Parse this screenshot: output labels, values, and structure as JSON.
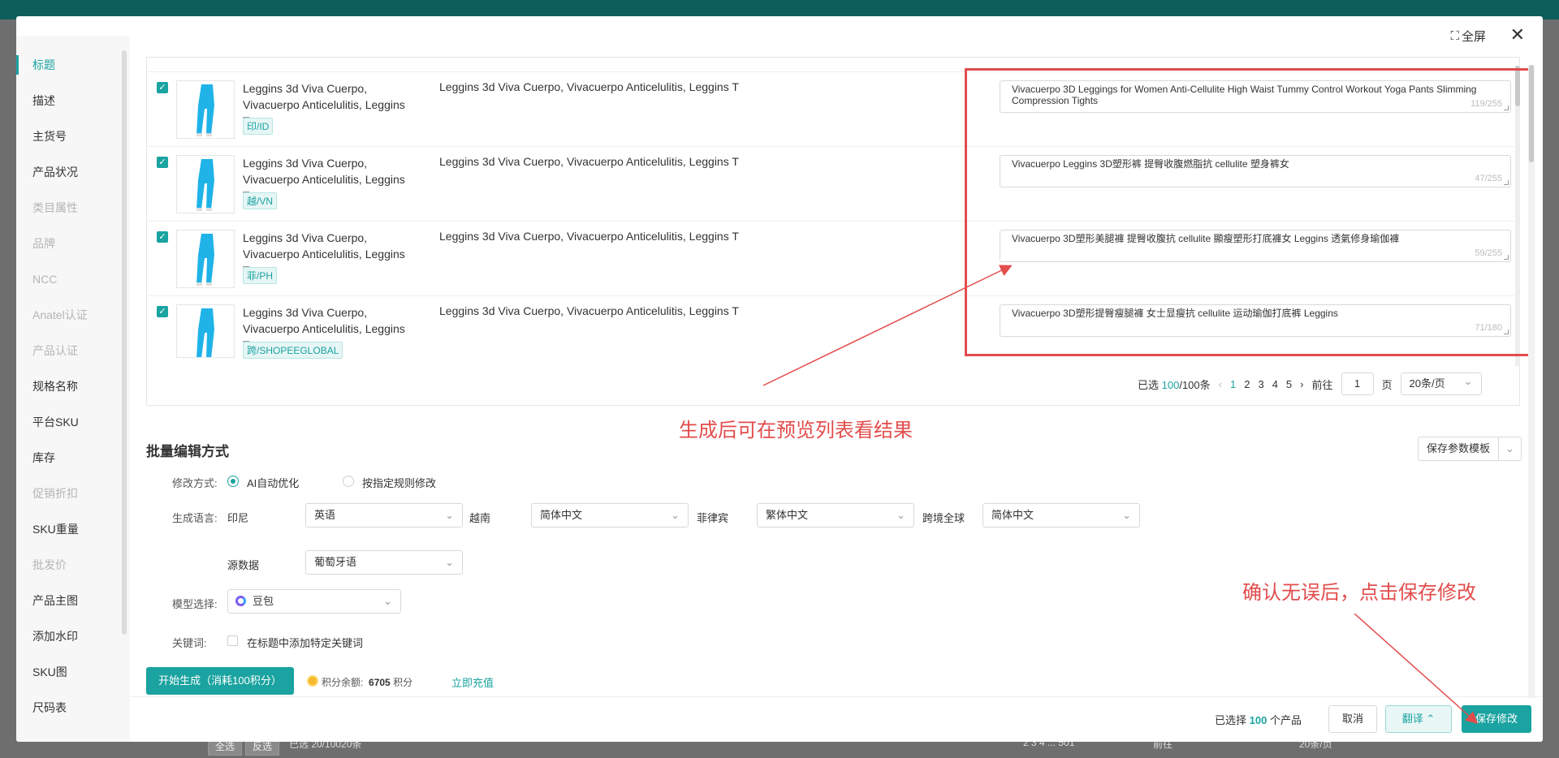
{
  "modal": {
    "fullscreen_label": "全屏"
  },
  "sidebar": {
    "items": [
      {
        "label": "标题",
        "state": "active"
      },
      {
        "label": "描述",
        "state": "normal"
      },
      {
        "label": "主货号",
        "state": "normal"
      },
      {
        "label": "产品状况",
        "state": "normal"
      },
      {
        "label": "类目属性",
        "state": "disabled"
      },
      {
        "label": "品牌",
        "state": "disabled"
      },
      {
        "label": "NCC",
        "state": "disabled"
      },
      {
        "label": "Anatel认证",
        "state": "disabled"
      },
      {
        "label": "产品认证",
        "state": "disabled"
      },
      {
        "label": "规格名称",
        "state": "normal"
      },
      {
        "label": "平台SKU",
        "state": "normal"
      },
      {
        "label": "库存",
        "state": "normal"
      },
      {
        "label": "促销折扣",
        "state": "disabled"
      },
      {
        "label": "SKU重量",
        "state": "normal"
      },
      {
        "label": "批发价",
        "state": "disabled"
      },
      {
        "label": "产品主图",
        "state": "normal"
      },
      {
        "label": "添加水印",
        "state": "normal"
      },
      {
        "label": "SKU图",
        "state": "normal"
      },
      {
        "label": "尺码表",
        "state": "normal"
      }
    ]
  },
  "rows": [
    {
      "title": "Leggins 3d Viva Cuerpo, Vivacuerpo Anticelulitis, Leggins T",
      "tag": "印/ID",
      "original": "Leggins 3d Viva Cuerpo, Vivacuerpo Anticelulitis, Leggins T",
      "generated": "Vivacuerpo 3D Leggings for Women Anti-Cellulite High Waist Tummy Control Workout Yoga Pants Slimming Compression Tights",
      "count": "119/255"
    },
    {
      "title": "Leggins 3d Viva Cuerpo, Vivacuerpo Anticelulitis, Leggins T",
      "tag": "越/VN",
      "original": "Leggins 3d Viva Cuerpo, Vivacuerpo Anticelulitis, Leggins T",
      "generated": "Vivacuerpo Leggins 3D塑形裤 提臀收腹燃脂抗 cellulite 塑身裤女",
      "count": "47/255"
    },
    {
      "title": "Leggins 3d Viva Cuerpo, Vivacuerpo Anticelulitis, Leggins T",
      "tag": "菲/PH",
      "original": "Leggins 3d Viva Cuerpo, Vivacuerpo Anticelulitis, Leggins T",
      "generated": "Vivacuerpo 3D塑形美腿褲 提臀收腹抗 cellulite 顯瘦塑形打底褲女 Leggins 透氣修身瑜伽褲",
      "count": "59/255"
    },
    {
      "title": "Leggins 3d Viva Cuerpo, Vivacuerpo Anticelulitis, Leggins T",
      "tag": "跨/SHOPEEGLOBAL",
      "original": "Leggins 3d Viva Cuerpo, Vivacuerpo Anticelulitis, Leggins T",
      "generated": "Vivacuerpo 3D塑形提臀瘦腿褲 女士显瘦抗 cellulite 运动瑜伽打底裤 Leggins",
      "count": "71/180"
    }
  ],
  "pager": {
    "selected_prefix": "已选 ",
    "selected": "100",
    "total_suffix": "/100条",
    "pages": [
      "1",
      "2",
      "3",
      "4",
      "5"
    ],
    "goto_label": "前往",
    "goto_value": "1",
    "page_unit": "页",
    "page_size": "20条/页"
  },
  "annotations": {
    "preview": "生成后可在预览列表看结果",
    "save": "确认无误后，点击保存修改"
  },
  "batch": {
    "section_title": "批量编辑方式",
    "template_button": "保存参数模板",
    "mode_label": "修改方式:",
    "mode_ai": "AI自动优化",
    "mode_rule": "按指定规则修改",
    "lang_label": "生成语言:",
    "langs": [
      {
        "site": "印尼",
        "value": "英语"
      },
      {
        "site": "越南",
        "value": "简体中文"
      },
      {
        "site": "菲律宾",
        "value": "繁体中文"
      },
      {
        "site": "跨境全球",
        "value": "简体中文"
      }
    ],
    "source_label": "源数据",
    "source_value": "葡萄牙语",
    "model_label": "模型选择:",
    "model_value": "豆包",
    "keyword_label": "关键词:",
    "keyword_option": "在标题中添加特定关键词",
    "generate_button": "开始生成（消耗100积分）",
    "points_label": "积分余额:",
    "points_value": "6705",
    "points_unit": "积分",
    "recharge": "立即充值"
  },
  "footer": {
    "selected_prefix": "已选择",
    "selected_count": "100",
    "selected_suffix": "个产品",
    "cancel": "取消",
    "translate": "翻译",
    "save": "保存修改"
  },
  "background": {
    "btn1": "全选",
    "btn2": "反选",
    "sel_info": "已选 20/10020条",
    "pages": "2  3  4  ...  501",
    "goto": "前往",
    "size": "20条/页"
  },
  "colors": {
    "accent": "#1aa3a0",
    "annotation": "#e34c4c"
  }
}
